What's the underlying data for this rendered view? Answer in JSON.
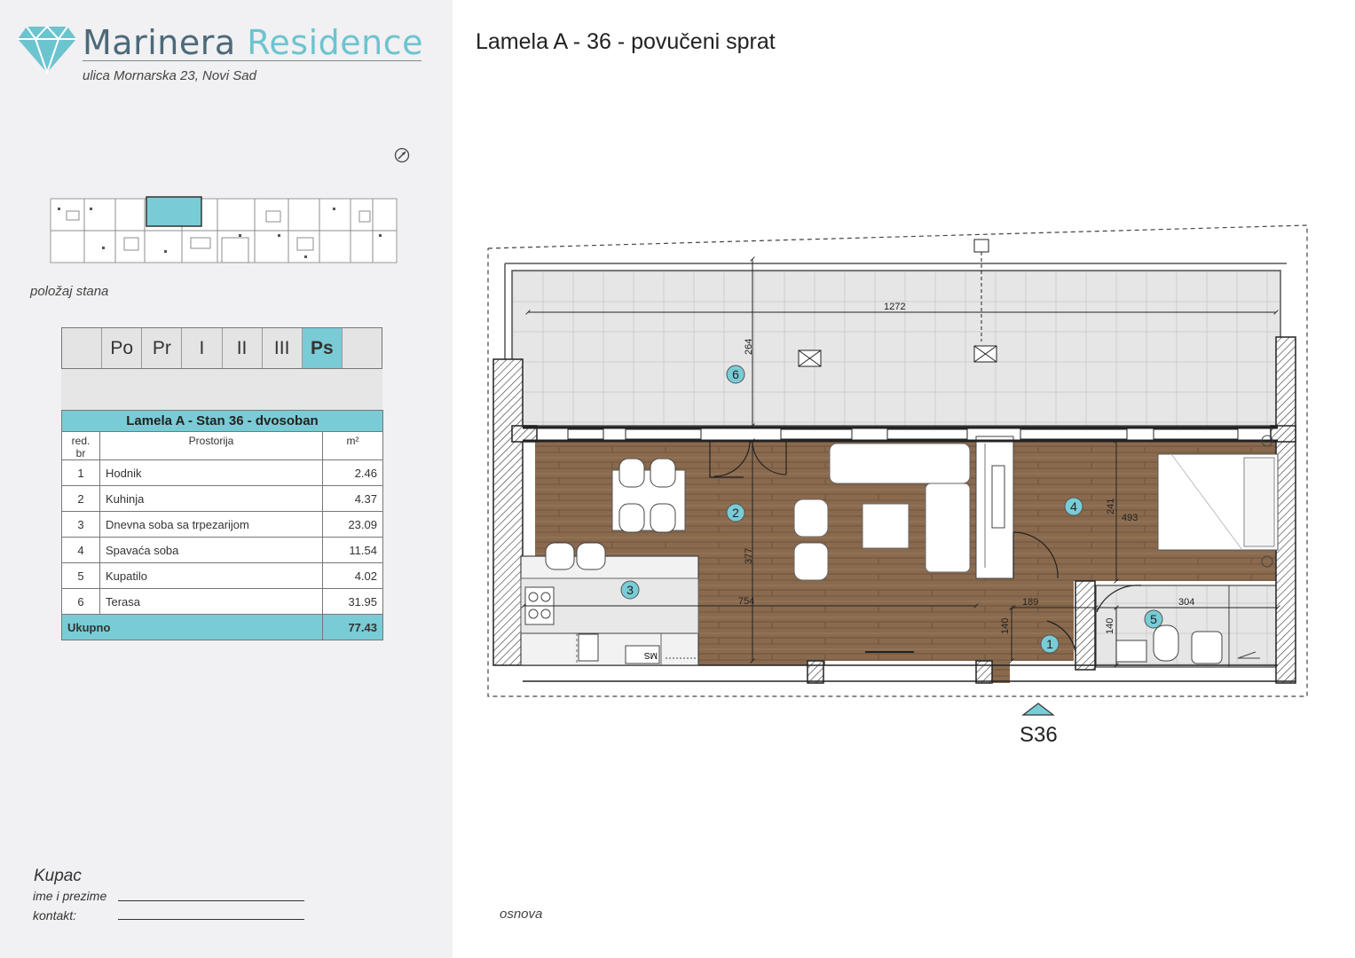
{
  "brand": {
    "name_part1": "Marinera",
    "name_part2": "Residence",
    "address": "ulica Mornarska 23, Novi Sad"
  },
  "icons": {
    "logo": "diamond-icon",
    "compass": "compass-icon"
  },
  "colors": {
    "accent": "#79ccd6",
    "brand_dark": "#4b6a7a",
    "brand_light": "#6cc4cf",
    "wood": "#8a6a4e"
  },
  "keyplan": {
    "caption": "položaj stana"
  },
  "floors": {
    "items": [
      "Po",
      "Pr",
      "I",
      "II",
      "III",
      "Ps"
    ],
    "active": "Ps"
  },
  "room_table": {
    "title": "Lamela A - Stan 36 - dvosoban",
    "headers": {
      "no": "red. br",
      "room": "Prostorija",
      "area": "m²"
    },
    "rows": [
      {
        "no": "1",
        "room": "Hodnik",
        "area": "2.46"
      },
      {
        "no": "2",
        "room": "Kuhinja",
        "area": "4.37"
      },
      {
        "no": "3",
        "room": "Dnevna soba sa trpezarijom",
        "area": "23.09"
      },
      {
        "no": "4",
        "room": "Spavaća soba",
        "area": "11.54"
      },
      {
        "no": "5",
        "room": "Kupatilo",
        "area": "4.02"
      },
      {
        "no": "6",
        "room": "Terasa",
        "area": "31.95"
      }
    ],
    "total": {
      "label": "Ukupno",
      "area": "77.43"
    }
  },
  "buyer": {
    "title": "Kupac",
    "name_label": "ime i prezime",
    "contact_label": "kontakt:"
  },
  "plan": {
    "title": "Lamela A - 36 - povučeni sprat",
    "label": "osnova",
    "section_marker": "S36",
    "room_markers": [
      "1",
      "2",
      "3",
      "4",
      "5",
      "6"
    ],
    "dimensions": {
      "terrace_width": "1272",
      "terrace_depth": "264",
      "living_depth": "377",
      "living_width": "754",
      "bedroom_depth": "241",
      "bedroom_width": "493",
      "hall_width": "189",
      "hall_depth": "140",
      "bath_depth": "140",
      "bath_width": "304"
    },
    "fixture_label": "MS"
  }
}
